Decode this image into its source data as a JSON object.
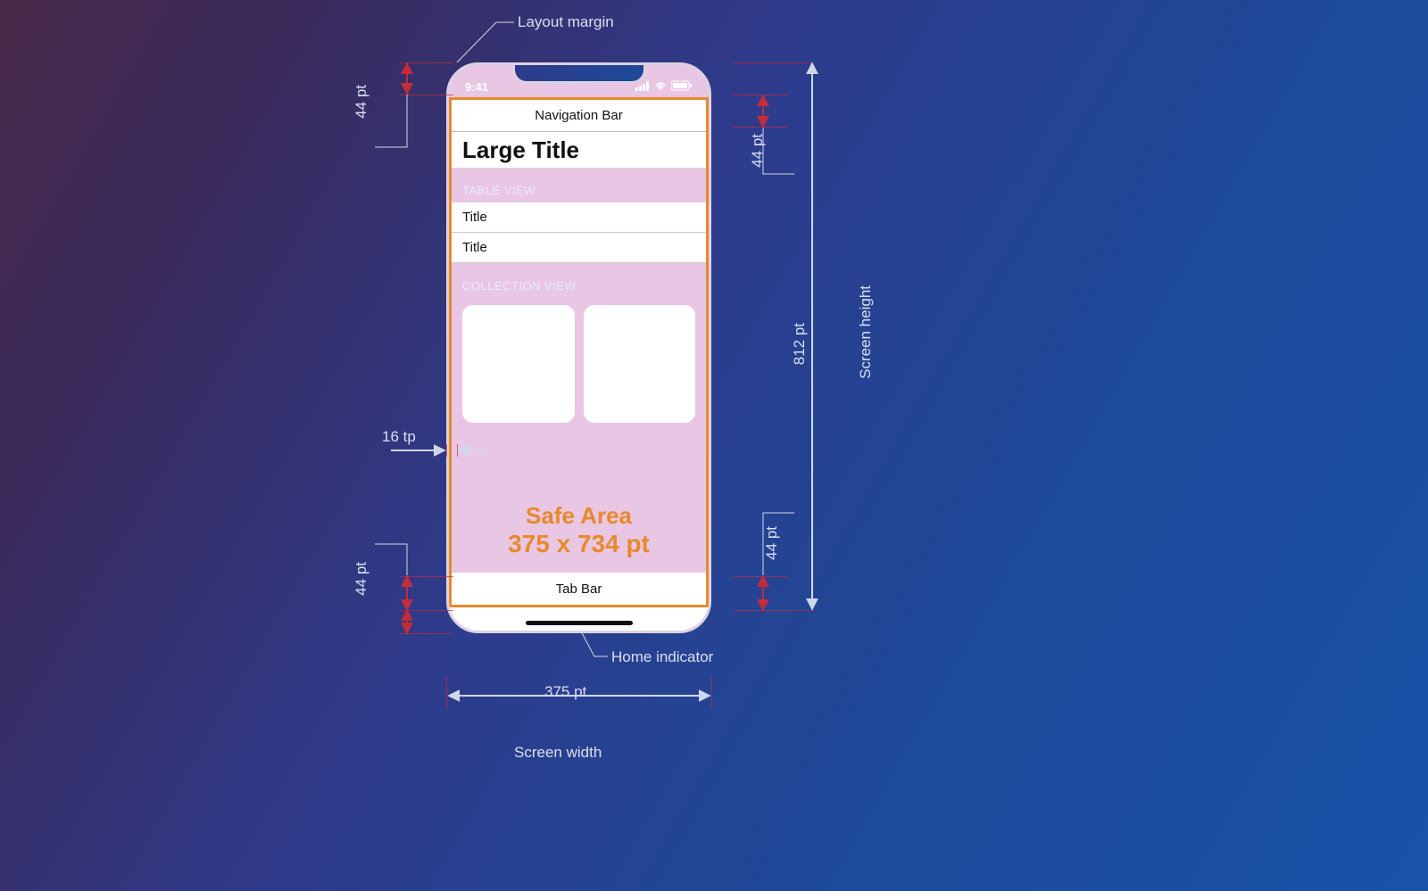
{
  "annotations": {
    "layout_margin": "Layout margin",
    "home_indicator": "Home indicator",
    "screen_width_label": "Screen width",
    "screen_height_label": "Screen height",
    "margin_value": "16 tp"
  },
  "measurements": {
    "status_bar_height": "44 pt",
    "nav_bar_height": "44 pt",
    "tab_bar_height": "44 pt",
    "home_indicator_area": "44 pt",
    "screen_width": "375 pt",
    "screen_height": "812 pt"
  },
  "phone": {
    "status_time": "9:41",
    "nav_bar": "Navigation Bar",
    "large_title": "Large Title",
    "table_header": "TABLE VIEW",
    "row1": "Title",
    "row2": "Title",
    "collection_header": "COLLECTION VIEW",
    "safe_area_line1": "Safe Area",
    "safe_area_line2": "375 x 734 pt",
    "tab_bar": "Tab Bar"
  }
}
